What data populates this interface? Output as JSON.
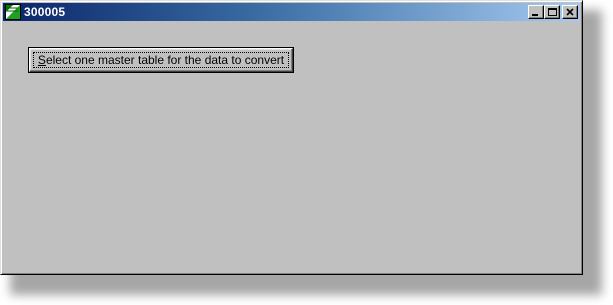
{
  "window": {
    "title": "300005",
    "icon": "app-icon",
    "controls": {
      "minimize_icon": "minimize-icon",
      "maximize_icon": "maximize-icon",
      "close_icon": "close-icon"
    }
  },
  "main": {
    "select_button": {
      "accel_char": "S",
      "label_rest": "elect one master table for the data to convert"
    }
  },
  "colors": {
    "titlebar_start": "#0a246a",
    "titlebar_end": "#a6caf0",
    "face": "#c0c0c0"
  }
}
